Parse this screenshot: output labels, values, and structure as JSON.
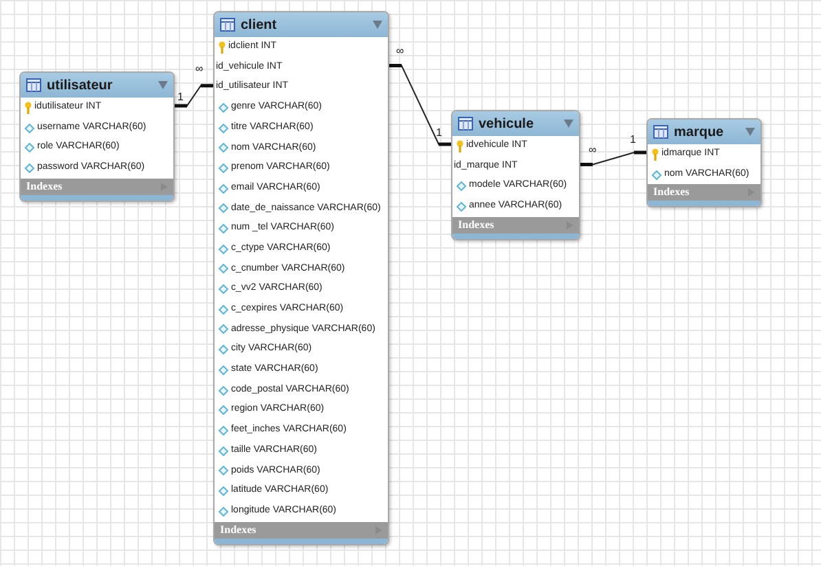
{
  "tables": [
    {
      "name": "utilisateur",
      "columns": [
        {
          "kind": "pk",
          "label": "idutilisateur INT"
        },
        {
          "kind": "attr",
          "label": "username VARCHAR(60)"
        },
        {
          "kind": "attr",
          "label": "role VARCHAR(60)"
        },
        {
          "kind": "attr",
          "label": "password VARCHAR(60)"
        }
      ],
      "indexes": "Indexes"
    },
    {
      "name": "client",
      "columns": [
        {
          "kind": "pk",
          "label": "idclient INT"
        },
        {
          "kind": "fk",
          "label": "id_vehicule INT"
        },
        {
          "kind": "fk",
          "label": "id_utilisateur INT"
        },
        {
          "kind": "attr",
          "label": "genre VARCHAR(60)"
        },
        {
          "kind": "attr",
          "label": "titre VARCHAR(60)"
        },
        {
          "kind": "attr",
          "label": "nom VARCHAR(60)"
        },
        {
          "kind": "attr",
          "label": "prenom VARCHAR(60)"
        },
        {
          "kind": "attr",
          "label": "email VARCHAR(60)"
        },
        {
          "kind": "attr",
          "label": "date_de_naissance VARCHAR(60)"
        },
        {
          "kind": "attr",
          "label": "num _tel VARCHAR(60)"
        },
        {
          "kind": "attr",
          "label": "c_ctype VARCHAR(60)"
        },
        {
          "kind": "attr",
          "label": "c_cnumber VARCHAR(60)"
        },
        {
          "kind": "attr",
          "label": "c_vv2 VARCHAR(60)"
        },
        {
          "kind": "attr",
          "label": "c_cexpires VARCHAR(60)"
        },
        {
          "kind": "attr",
          "label": "adresse_physique VARCHAR(60)"
        },
        {
          "kind": "attr",
          "label": "city VARCHAR(60)"
        },
        {
          "kind": "attr",
          "label": "state VARCHAR(60)"
        },
        {
          "kind": "attr",
          "label": "code_postal VARCHAR(60)"
        },
        {
          "kind": "attr",
          "label": "region VARCHAR(60)"
        },
        {
          "kind": "attr",
          "label": "feet_inches VARCHAR(60)"
        },
        {
          "kind": "attr",
          "label": "taille VARCHAR(60)"
        },
        {
          "kind": "attr",
          "label": "poids VARCHAR(60)"
        },
        {
          "kind": "attr",
          "label": "latitude VARCHAR(60)"
        },
        {
          "kind": "attr",
          "label": "longitude VARCHAR(60)"
        }
      ],
      "indexes": "Indexes"
    },
    {
      "name": "vehicule",
      "columns": [
        {
          "kind": "pk",
          "label": "idvehicule INT"
        },
        {
          "kind": "fk",
          "label": "id_marque INT"
        },
        {
          "kind": "attr",
          "label": "modele VARCHAR(60)"
        },
        {
          "kind": "attr",
          "label": "annee VARCHAR(60)"
        }
      ],
      "indexes": "Indexes"
    },
    {
      "name": "marque",
      "columns": [
        {
          "kind": "pk",
          "label": "idmarque INT"
        },
        {
          "kind": "attr",
          "label": "nom VARCHAR(60)"
        }
      ],
      "indexes": "Indexes"
    }
  ],
  "relationships": [
    {
      "from_card": "1",
      "to_card": "∞"
    },
    {
      "from_card": "∞",
      "to_card": "1"
    },
    {
      "from_card": "∞",
      "to_card": "1"
    }
  ]
}
